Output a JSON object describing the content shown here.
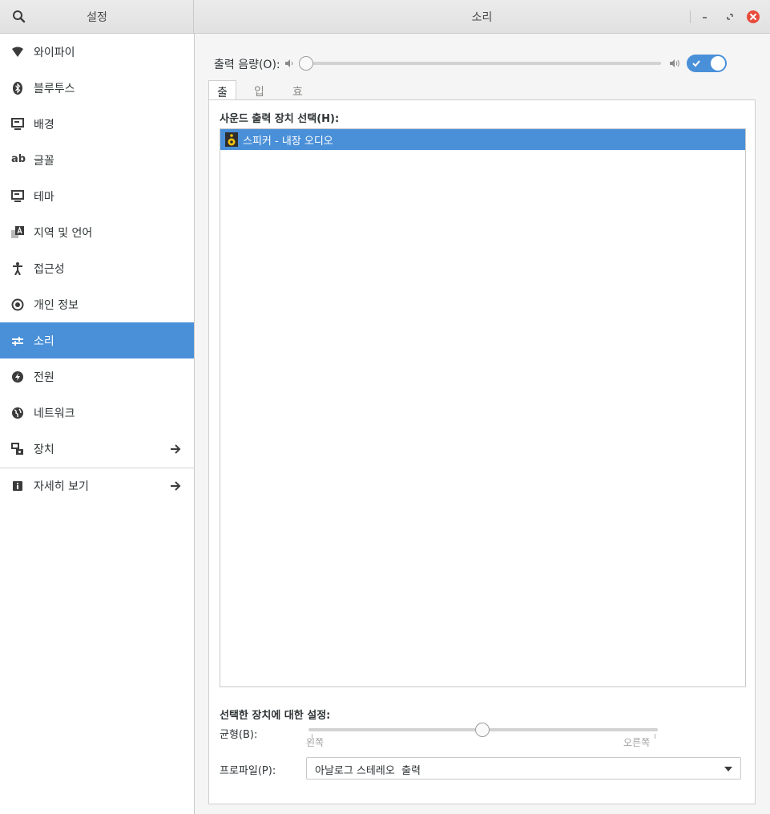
{
  "header": {
    "left_title": "설정",
    "right_title": "소리"
  },
  "sidebar": {
    "items": [
      {
        "label": "와이파이",
        "icon": "wifi-icon"
      },
      {
        "label": "블루투스",
        "icon": "bluetooth-icon"
      },
      {
        "label": "배경",
        "icon": "background-icon"
      },
      {
        "label": "글꼴",
        "icon": "font-icon"
      },
      {
        "label": "테마",
        "icon": "theme-icon"
      },
      {
        "label": "지역 및 언어",
        "icon": "region-icon"
      },
      {
        "label": "접근성",
        "icon": "accessibility-icon"
      },
      {
        "label": "개인 정보",
        "icon": "privacy-icon"
      },
      {
        "label": "소리",
        "icon": "sound-icon",
        "active": true
      },
      {
        "label": "전원",
        "icon": "power-icon"
      },
      {
        "label": "네트워크",
        "icon": "network-icon"
      },
      {
        "label": "장치",
        "icon": "devices-icon"
      },
      {
        "label": "자세히 보기",
        "icon": "details-icon"
      }
    ]
  },
  "main": {
    "volume_label": "출력 음량(O):",
    "volume_level": 0,
    "mute_switch_on": true,
    "tabs": [
      {
        "label": "출력",
        "active": true
      },
      {
        "label": "입력"
      },
      {
        "label": "효과음"
      }
    ],
    "device_section_title": "사운드 출력 장치 선택(H):",
    "devices": [
      {
        "label": "스피커 - 내장 오디오",
        "selected": true
      }
    ],
    "settings_title": "선택한 장치에 대한 설정:",
    "balance_label": "균형(B):",
    "balance_value": 0.5,
    "balance_left": "왼쪽",
    "balance_right": "오른쪽",
    "profile_label": "프로파일(P):",
    "profile_value": "아날로그 스테레오  출력"
  },
  "colors": {
    "accent": "#4a90d9",
    "close": "#e74c3c"
  }
}
